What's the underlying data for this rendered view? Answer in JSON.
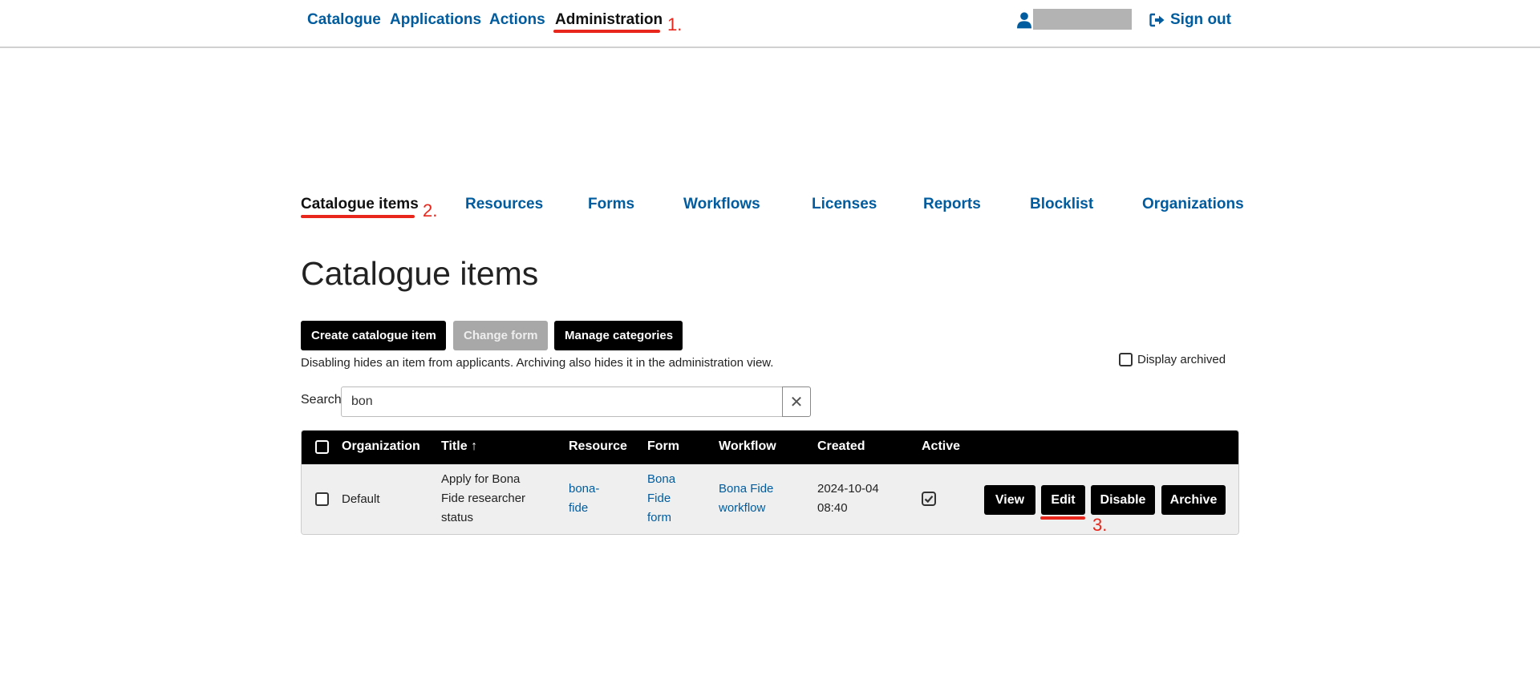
{
  "topnav": {
    "links": [
      "Catalogue",
      "Applications",
      "Actions",
      "Administration"
    ],
    "active": "Administration",
    "annotation_1": "1.",
    "sign_out": "Sign out",
    "user_icon": "user-icon",
    "sign_out_icon": "sign-out-icon"
  },
  "tabs": {
    "items": [
      "Catalogue items",
      "Resources",
      "Forms",
      "Workflows",
      "Licenses",
      "Reports",
      "Blocklist",
      "Organizations"
    ],
    "annotation_2": "2."
  },
  "page": {
    "title": "Catalogue items",
    "buttons": {
      "create": "Create catalogue item",
      "change_form": "Change form",
      "manage_categories": "Manage categories"
    },
    "hint": "Disabling hides an item from applicants. Archiving also hides it in the administration view.",
    "display_archived": "Display archived",
    "search_label": "Search",
    "search_value": "bon",
    "search_clear": "✕"
  },
  "table": {
    "headers": {
      "organization": "Organization",
      "title": "Title",
      "title_sort": "↑",
      "resource": "Resource",
      "form": "Form",
      "workflow": "Workflow",
      "created": "Created",
      "active": "Active"
    },
    "rows": [
      {
        "organization": "Default",
        "title_lines": [
          "Apply for Bona",
          "Fide researcher",
          "status"
        ],
        "resource_lines": [
          "bona-",
          "fide"
        ],
        "form_lines": [
          "Bona",
          "Fide",
          "form"
        ],
        "workflow_lines": [
          "Bona Fide",
          "workflow"
        ],
        "created_lines": [
          "2024-10-04",
          "08:40"
        ],
        "active": true,
        "actions": [
          "View",
          "Edit",
          "Disable",
          "Archive"
        ]
      }
    ],
    "annotation_3": "3."
  },
  "colors": {
    "link": "#005c9e",
    "annotation": "#e8261b",
    "header_bg": "#000000",
    "row_bg": "#efefef"
  }
}
